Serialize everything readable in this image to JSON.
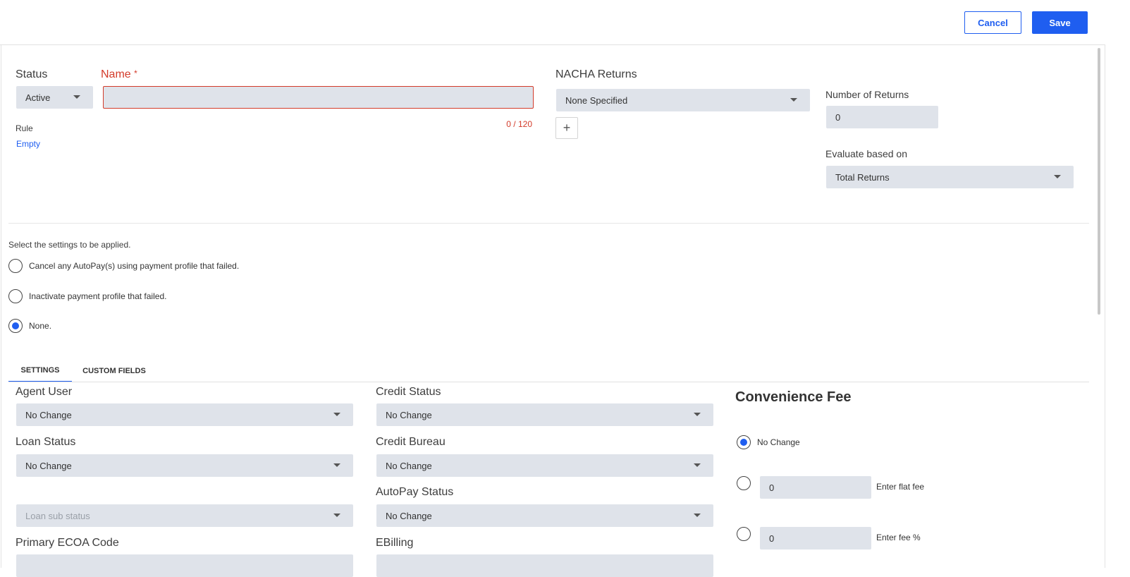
{
  "toolbar": {
    "cancel_label": "Cancel",
    "save_label": "Save"
  },
  "status": {
    "label": "Status",
    "value": "Active"
  },
  "name": {
    "label": "Name",
    "required_mark": "*",
    "value": "",
    "counter": "0 / 120"
  },
  "rule": {
    "label": "Rule",
    "value": "Empty"
  },
  "nacha": {
    "label": "NACHA Returns",
    "value": "None Specified",
    "add_label": "+"
  },
  "returns": {
    "count_label": "Number of Returns",
    "count_value": "0",
    "evaluate_label": "Evaluate based on",
    "evaluate_value": "Total Returns"
  },
  "settings_prompt": "Select the settings to be applied.",
  "apply_options": [
    {
      "label": "Cancel any AutoPay(s) using payment profile that failed.",
      "checked": false
    },
    {
      "label": "Inactivate payment profile that failed.",
      "checked": false
    },
    {
      "label": "None.",
      "checked": true
    }
  ],
  "tabs": [
    {
      "label": "SETTINGS",
      "active": true
    },
    {
      "label": "CUSTOM FIELDS",
      "active": false
    }
  ],
  "fields": {
    "agent_user": {
      "label": "Agent User",
      "value": "No Change"
    },
    "loan_status": {
      "label": "Loan Status",
      "value": "No Change"
    },
    "loan_sub_status": {
      "placeholder": "Loan sub status"
    },
    "primary_ecoa": {
      "label": "Primary ECOA Code"
    },
    "credit_status": {
      "label": "Credit Status",
      "value": "No Change"
    },
    "credit_bureau": {
      "label": "Credit Bureau",
      "value": "No Change"
    },
    "autopay_status": {
      "label": "AutoPay Status",
      "value": "No Change"
    },
    "ebilling": {
      "label": "EBilling"
    }
  },
  "convenience_fee": {
    "title": "Convenience Fee",
    "options": [
      {
        "label": "No Change",
        "checked": true
      },
      {
        "value": "0",
        "label": "Enter flat fee",
        "checked": false
      },
      {
        "value": "0",
        "label": "Enter fee %",
        "checked": false
      }
    ]
  },
  "colors": {
    "accent": "#1f5ef0",
    "error": "#d33b2a",
    "field_bg": "#dfe3ea"
  }
}
